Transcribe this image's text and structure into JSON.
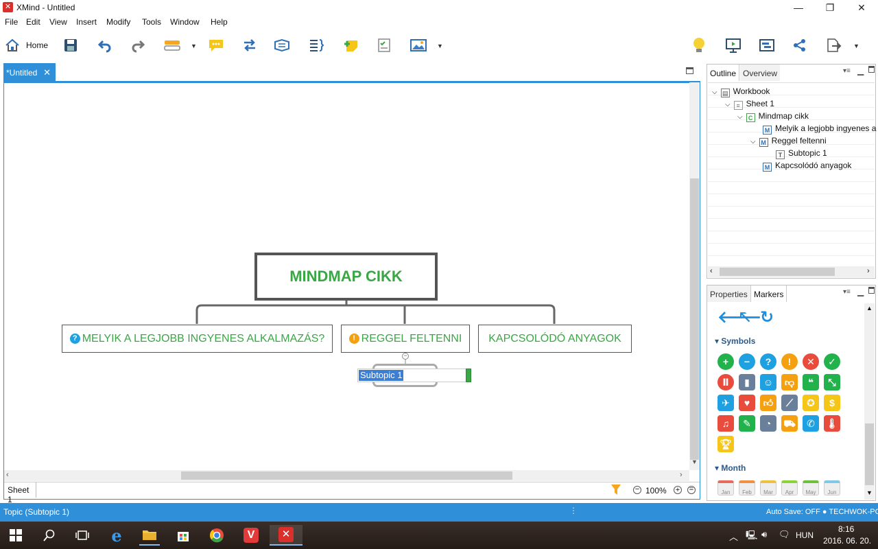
{
  "window": {
    "title": "XMind - Untitled",
    "logo": "✕"
  },
  "menu": [
    "File",
    "Edit",
    "View",
    "Insert",
    "Modify",
    "Tools",
    "Window",
    "Help"
  ],
  "toolbar": {
    "home_label": "Home"
  },
  "doc_tab": {
    "label": "*Untitled"
  },
  "mindmap": {
    "central": "MINDMAP CIKK",
    "topics": [
      "MELYIK A LEGJOBB INGYENES ALKALMAZÁS?",
      "REGGEL FELTENNI",
      "KAPCSOLÓDÓ ANYAGOK"
    ],
    "editing_subtopic": "Subtopic 1"
  },
  "sheetbar": {
    "sheet_tab": "Sheet 1",
    "zoom": "100%"
  },
  "outline_panel": {
    "tabs": [
      "Outline",
      "Overview"
    ],
    "tree": [
      {
        "label": "Workbook",
        "icon": "W"
      },
      {
        "label": "Sheet 1",
        "icon": "S"
      },
      {
        "label": "Mindmap cikk",
        "icon": "C"
      },
      {
        "label": "Melyik a legjobb ingyenes a",
        "icon": "M"
      },
      {
        "label": "Reggel feltenni",
        "icon": "M"
      },
      {
        "label": "Subtopic 1",
        "icon": "T"
      },
      {
        "label": "Kapcsolódó anyagok",
        "icon": "M"
      }
    ]
  },
  "markers_panel": {
    "tabs": [
      "Properties",
      "Markers"
    ],
    "section_symbols": "Symbols",
    "section_month": "Month",
    "months": [
      "Jan",
      "Feb",
      "Mar",
      "Apr",
      "May",
      "Jun"
    ]
  },
  "status": {
    "left": "Topic (Subtopic 1)",
    "right": "Auto Save: OFF  ● TECHWOK-PC"
  },
  "taskbar": {
    "lang": "HUN",
    "time": "8:16",
    "date": "2016. 06. 20."
  },
  "colors": {
    "accent": "#2f8fd8",
    "topic_text": "#3aa645"
  }
}
